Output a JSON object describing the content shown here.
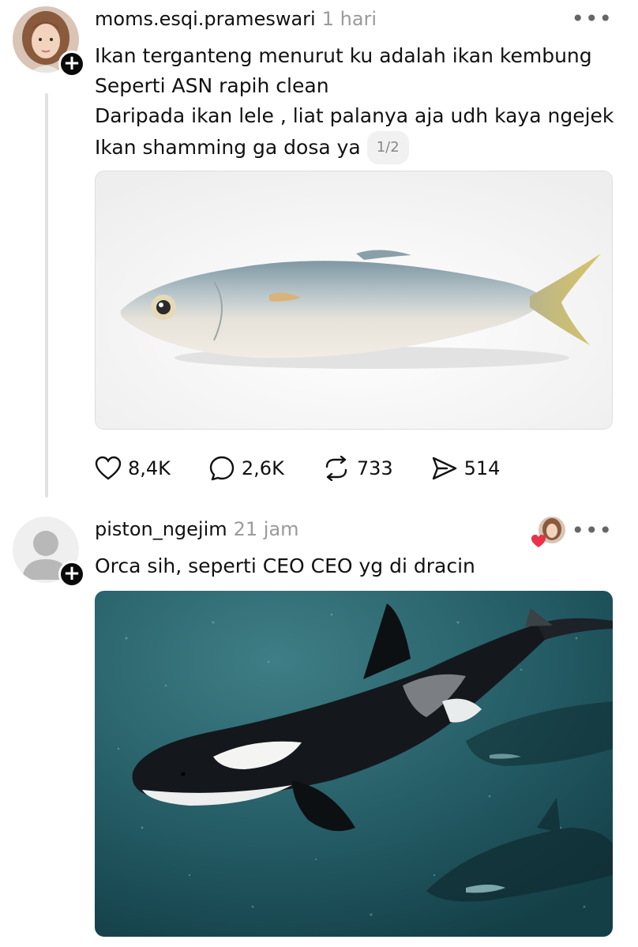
{
  "post1": {
    "username": "moms.esqi.prameswari",
    "time": "1 hari",
    "more_icon": "more-dots-icon",
    "lines": [
      "Ikan terganteng menurut ku adalah ikan kembung",
      "Seperti ASN rapih clean",
      "Daripada ikan lele , liat palanya aja udh kaya ngejek",
      "Ikan shamming ga dosa ya"
    ],
    "pager": "1/2",
    "image_subject": "mackerel fish",
    "stats": {
      "likes": "8,4K",
      "comments": "2,6K",
      "reposts": "733",
      "shares": "514"
    }
  },
  "post2": {
    "username": "piston_ngejim",
    "time": "21 jam",
    "more_icon": "more-dots-icon",
    "text": "Orca sih, seperti CEO CEO yg di dracin",
    "image_subject": "orca whales underwater",
    "liked_by_author": true
  },
  "colors": {
    "text": "#111111",
    "muted": "#9a9a9a",
    "thread_line": "#e2e2e2",
    "heart": "#e8334a",
    "ocean": "#1f5a63"
  }
}
